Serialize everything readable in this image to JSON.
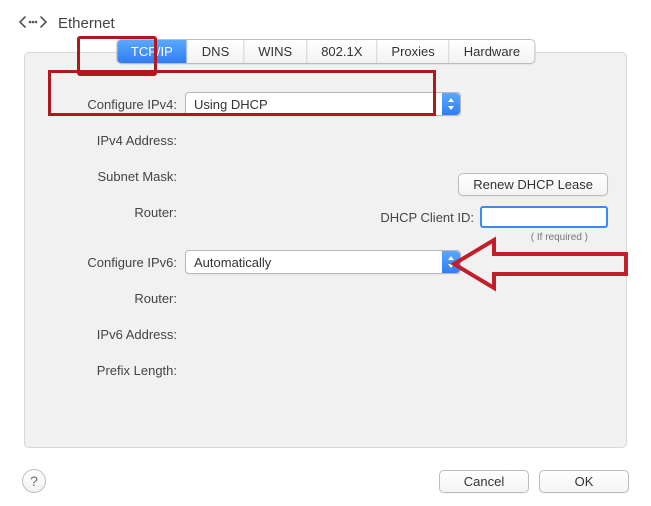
{
  "header": {
    "title": "Ethernet"
  },
  "tabs": [
    "TCP/IP",
    "DNS",
    "WINS",
    "802.1X",
    "Proxies",
    "Hardware"
  ],
  "selected_tab": 0,
  "ipv4": {
    "configure_label": "Configure IPv4:",
    "configure_value": "Using DHCP",
    "address_label": "IPv4 Address:",
    "subnet_label": "Subnet Mask:",
    "router_label": "Router:",
    "renew_button": "Renew DHCP Lease",
    "dhcp_client_id_label": "DHCP Client ID:",
    "dhcp_client_id_value": "",
    "if_required": "( If required )"
  },
  "ipv6": {
    "configure_label": "Configure IPv6:",
    "configure_value": "Automatically",
    "router_label": "Router:",
    "address_label": "IPv6 Address:",
    "prefix_label": "Prefix Length:"
  },
  "buttons": {
    "help": "?",
    "cancel": "Cancel",
    "ok": "OK"
  },
  "annotation": {
    "highlight_color": "#b0181e",
    "accent_color": "#3a8cf0"
  }
}
